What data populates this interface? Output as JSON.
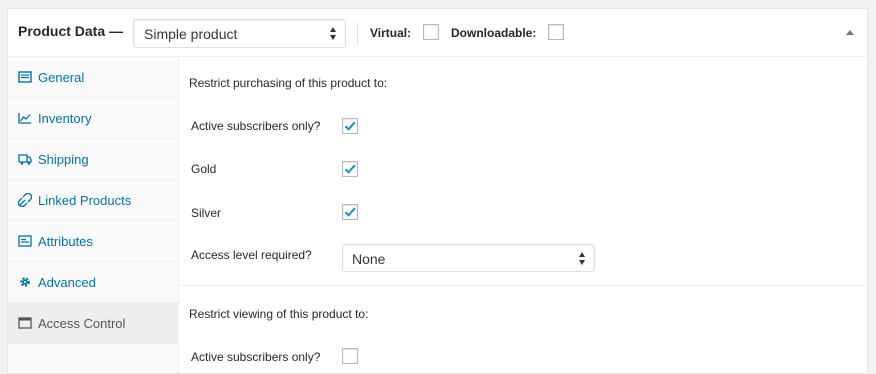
{
  "header": {
    "title": "Product Data —",
    "product_type": "Simple product",
    "virtual_label": "Virtual:",
    "virtual_checked": false,
    "downloadable_label": "Downloadable:",
    "downloadable_checked": false
  },
  "tabs": [
    {
      "label": "General",
      "icon": "general-icon",
      "active": false
    },
    {
      "label": "Inventory",
      "icon": "inventory-icon",
      "active": false
    },
    {
      "label": "Shipping",
      "icon": "truck-icon",
      "active": false
    },
    {
      "label": "Linked Products",
      "icon": "link-icon",
      "active": false
    },
    {
      "label": "Attributes",
      "icon": "attributes-icon",
      "active": false
    },
    {
      "label": "Advanced",
      "icon": "gear-icon",
      "active": false
    },
    {
      "label": "Access Control",
      "icon": "window-icon",
      "active": true
    }
  ],
  "purchase": {
    "title": "Restrict purchasing of this product to:",
    "active_subscribers_label": "Active subscribers only?",
    "active_subscribers_checked": true,
    "gold_label": "Gold",
    "gold_checked": true,
    "silver_label": "Silver",
    "silver_checked": true,
    "access_level_label": "Access level required?",
    "access_level_value": "None"
  },
  "viewing": {
    "title": "Restrict viewing of this product to:",
    "active_subscribers_label": "Active subscribers only?",
    "active_subscribers_checked": false
  },
  "colors": {
    "link": "#0073aa",
    "check": "#1e8cbe"
  }
}
